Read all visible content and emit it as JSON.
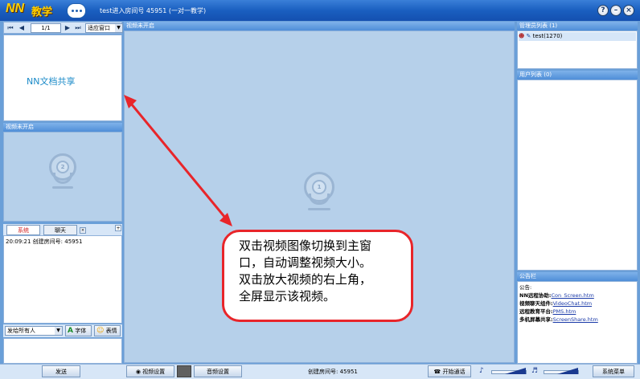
{
  "app": {
    "logo_nn": "NN",
    "logo_text": "教学",
    "window_title": "test进入房间号 45951 (一对一教学)"
  },
  "doc_toolbar": {
    "page": "1/1",
    "fit": "适应窗口"
  },
  "doc_share_label": "NN文档共享",
  "small_video": {
    "header": "视频未开启",
    "cam_number": "2"
  },
  "main_video": {
    "header": "视频未开启",
    "cam_number": "1"
  },
  "chat": {
    "tabs": [
      "系统",
      "聊天"
    ],
    "log": "20:09:21  创建房间号: 45951",
    "send_to": "发给所有人",
    "font_btn": "字体",
    "emoji_btn": "表情"
  },
  "admin": {
    "header": "管理员列表 (1)",
    "user": "test(1270)"
  },
  "users": {
    "header": "用户列表 (0)"
  },
  "notice": {
    "header": "公告栏",
    "title": "公告:",
    "rows": [
      {
        "label": "NN远程协助:",
        "link": "Con_Screen.htm"
      },
      {
        "label": "视频聊天组件:",
        "link": "VideoChat.htm"
      },
      {
        "label": "远程教育平台:",
        "link": "PMS.htm"
      },
      {
        "label": "多机屏幕共享:",
        "link": "ScreenShare.htm"
      }
    ]
  },
  "bottom": {
    "send": "发送",
    "video_settings": "视频设置",
    "audio_settings": "音频设置",
    "room_status": "创建房间号: 45951",
    "start_talk": "开始通话",
    "system_menu": "系统菜单"
  },
  "callout_lines": [
    "双击视频图像切换到主窗",
    "口，自动调整视频大小。",
    "双击放大视频的右上角，",
    "全屏显示该视频。"
  ],
  "colors": {
    "accent": "#1a5fc0",
    "callout": "#e8252a",
    "video_bg": "#b6d0ea"
  }
}
